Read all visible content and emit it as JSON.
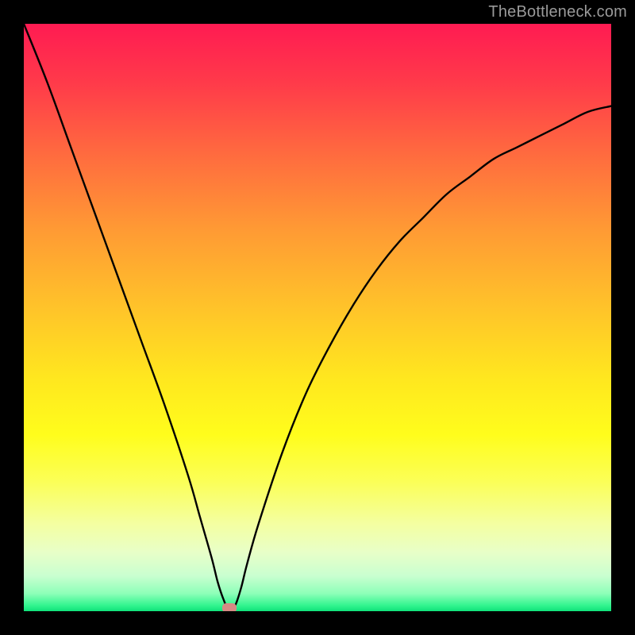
{
  "watermark": "TheBottleneck.com",
  "chart_data": {
    "type": "line",
    "title": "",
    "xlabel": "",
    "ylabel": "",
    "xlim": [
      0,
      100
    ],
    "ylim": [
      0,
      100
    ],
    "grid": false,
    "legend": false,
    "background_gradient": {
      "top": "#ff1b52",
      "mid": "#ffe61f",
      "bottom": "#10e27a"
    },
    "series": [
      {
        "name": "bottleneck-curve",
        "color": "#000000",
        "x": [
          0,
          4,
          8,
          12,
          16,
          20,
          24,
          28,
          30,
          32,
          33,
          34,
          35,
          36,
          37,
          38,
          40,
          44,
          48,
          52,
          56,
          60,
          64,
          68,
          72,
          76,
          80,
          84,
          88,
          92,
          96,
          100
        ],
        "y": [
          100,
          90,
          79,
          68,
          57,
          46,
          35,
          23,
          16,
          9,
          5,
          2,
          0,
          1,
          4,
          8,
          15,
          27,
          37,
          45,
          52,
          58,
          63,
          67,
          71,
          74,
          77,
          79,
          81,
          83,
          85,
          86
        ]
      }
    ],
    "marker": {
      "x": 35,
      "y": 0,
      "color": "#d68a84"
    }
  }
}
